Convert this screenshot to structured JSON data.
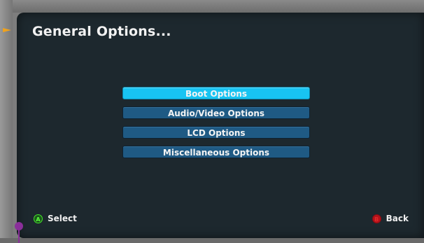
{
  "screen": {
    "title": "General Options..."
  },
  "menu": {
    "items": [
      {
        "label": "Boot Options",
        "selected": true
      },
      {
        "label": "Audio/Video Options",
        "selected": false
      },
      {
        "label": "LCD Options",
        "selected": false
      },
      {
        "label": "Miscellaneous Options",
        "selected": false
      }
    ]
  },
  "hints": {
    "select": {
      "button": "A",
      "label": "Select"
    },
    "back": {
      "button": "B",
      "label": "Back"
    }
  },
  "colors": {
    "background": "#1d282e",
    "menu_item": "#1f5a84",
    "menu_item_selected": "#18c4f2",
    "button_a": "#46e32b",
    "button_b": "#b4121a",
    "pointer_arrow": "#f0a21c",
    "pin": "#8a2f9a"
  }
}
